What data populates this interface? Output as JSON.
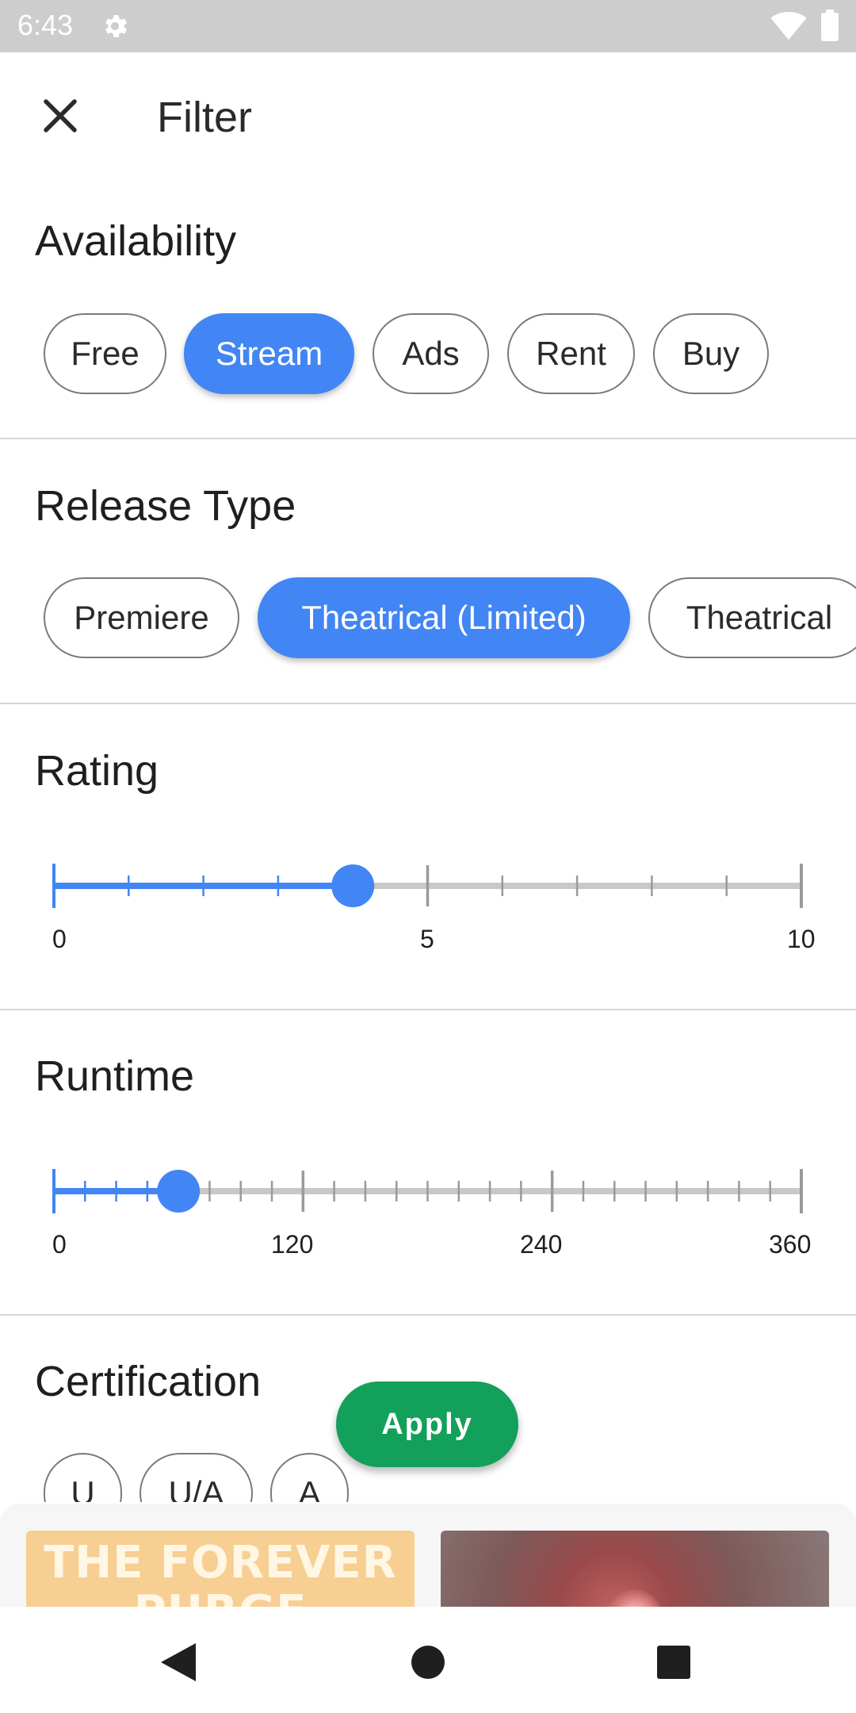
{
  "status_bar": {
    "time": "6:43",
    "icons": [
      "settings-gear-icon",
      "wifi-icon",
      "battery-icon"
    ]
  },
  "header": {
    "close_icon": "close-icon",
    "title": "Filter"
  },
  "availability": {
    "title": "Availability",
    "chips": [
      {
        "label": "Free",
        "selected": false
      },
      {
        "label": "Stream",
        "selected": true
      },
      {
        "label": "Ads",
        "selected": false
      },
      {
        "label": "Rent",
        "selected": false
      },
      {
        "label": "Buy",
        "selected": false
      }
    ]
  },
  "release_type": {
    "title": "Release Type",
    "chips": [
      {
        "label": "Premiere",
        "selected": false
      },
      {
        "label": "Theatrical (Limited)",
        "selected": true
      },
      {
        "label": "Theatrical",
        "selected": false
      }
    ]
  },
  "rating": {
    "title": "Rating",
    "min": 0,
    "max": 10,
    "step": 1,
    "value": 4,
    "tick_labels": [
      "0",
      "5",
      "10"
    ]
  },
  "runtime": {
    "title": "Runtime",
    "min": 0,
    "max": 360,
    "step": 15,
    "value": 60,
    "tick_labels": [
      "0",
      "120",
      "240",
      "360"
    ]
  },
  "certification": {
    "title": "Certification",
    "chips": [
      {
        "label": "U",
        "selected": false
      },
      {
        "label": "U/A",
        "selected": false
      },
      {
        "label": "A",
        "selected": false
      }
    ]
  },
  "apply_button": {
    "label": "Apply"
  },
  "posters": [
    {
      "title_text": "THE FOREVER PURGE"
    },
    {
      "title_text": ""
    }
  ],
  "nav_bar": {
    "icons": [
      "back-icon",
      "home-icon",
      "recents-icon"
    ]
  },
  "colors": {
    "accent": "#4285f4",
    "apply_green": "#13a05a",
    "status_bar": "#cdcdcd",
    "track_inactive": "#c8c8c8"
  }
}
